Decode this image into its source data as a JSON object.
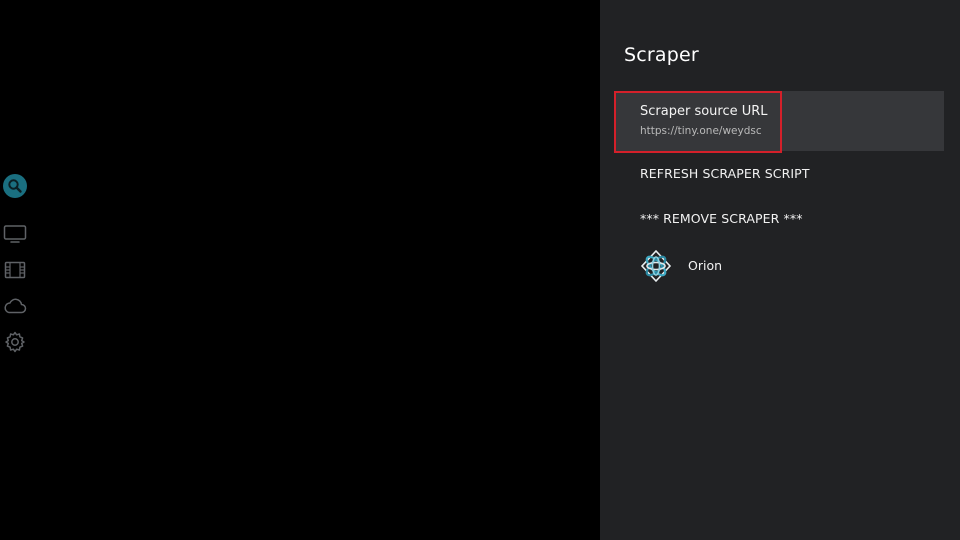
{
  "sidebar": {
    "items": [
      {
        "icon": "search-icon",
        "active": true
      },
      {
        "icon": "tv-icon",
        "active": false
      },
      {
        "icon": "film-icon",
        "active": false
      },
      {
        "icon": "cloud-icon",
        "active": false
      },
      {
        "icon": "gear-icon",
        "active": false
      }
    ],
    "active_color": "#1a6f80",
    "inactive_color": "#5f6266"
  },
  "panel": {
    "title": "Scraper",
    "items": [
      {
        "label": "Scraper source URL",
        "sublabel": "https://tiny.one/weydsc",
        "focused": true
      },
      {
        "label": "REFRESH SCRAPER SCRIPT"
      },
      {
        "label": "*** REMOVE SCRAPER ***"
      },
      {
        "label": "Orion",
        "icon": "orion-logo-icon"
      }
    ],
    "highlight_color": "#d4202a",
    "focus_background": "#36373a",
    "background": "#212224"
  }
}
